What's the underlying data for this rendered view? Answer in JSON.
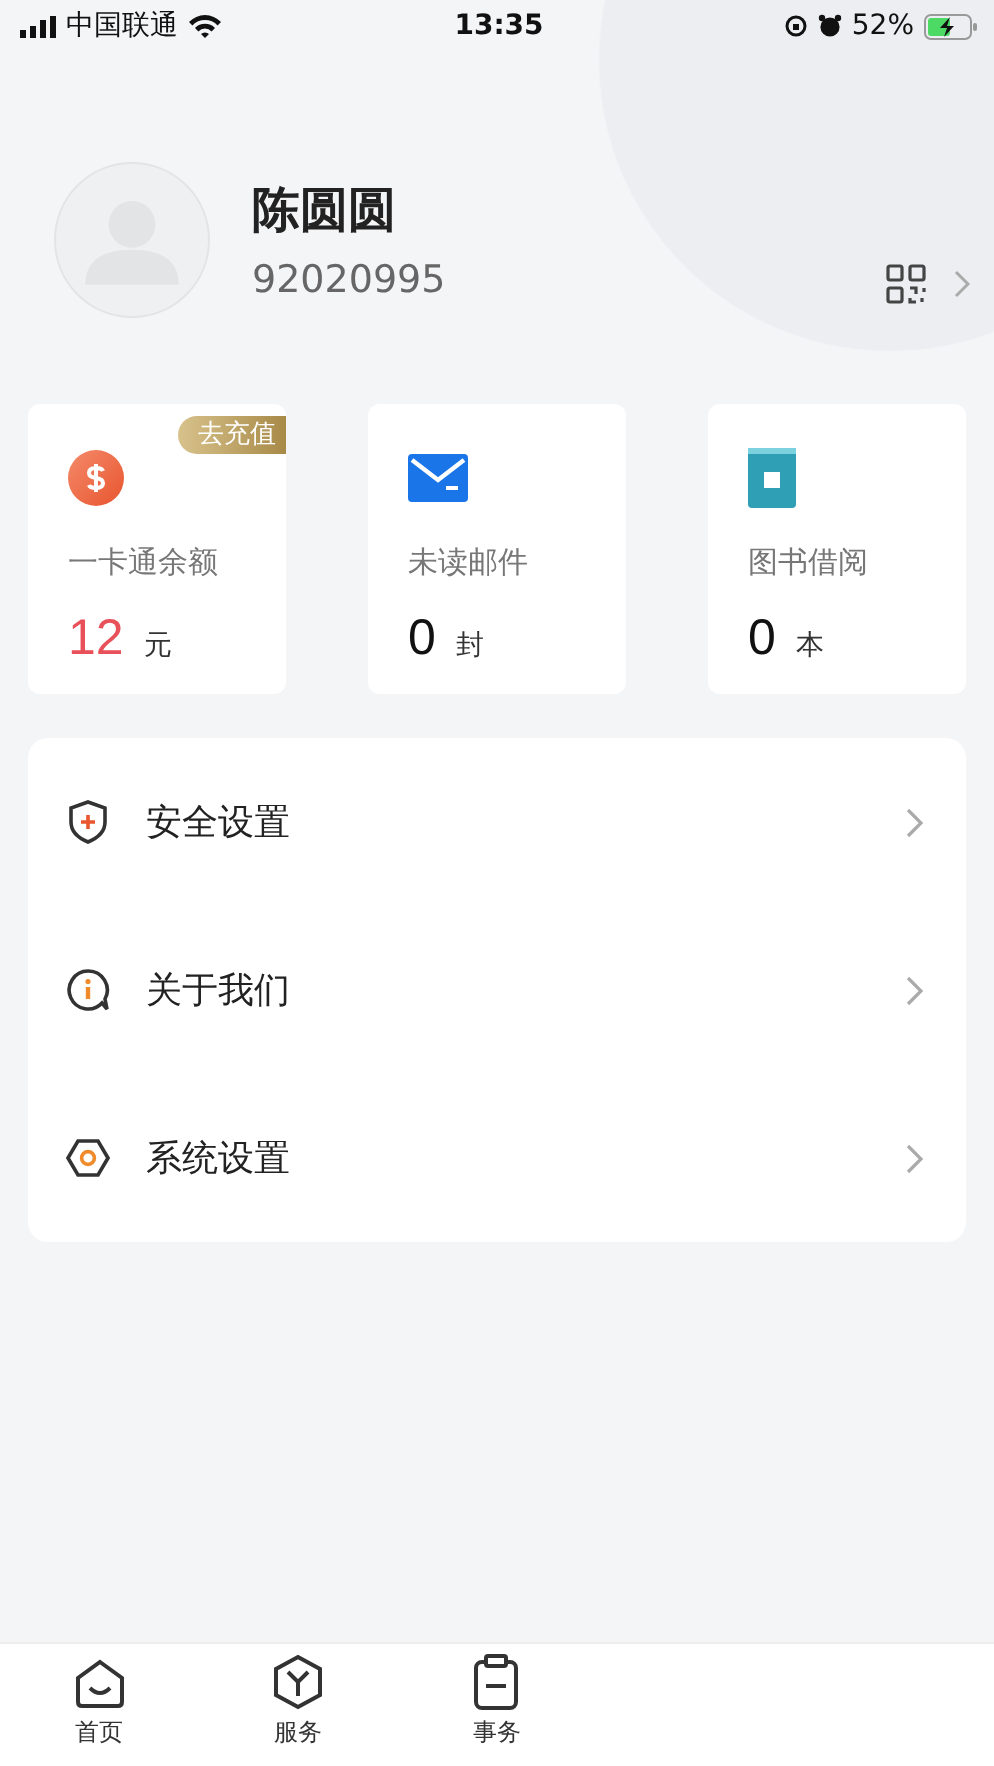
{
  "status_bar": {
    "carrier": "中国联通",
    "time": "13:35",
    "battery": "52%"
  },
  "profile": {
    "name": "陈圆圆",
    "id": "92020995"
  },
  "stats": [
    {
      "kind": "balance",
      "label": "一卡通余额",
      "value": "12",
      "unit": "元",
      "badge": "去充值"
    },
    {
      "kind": "mail",
      "label": "未读邮件",
      "value": "0",
      "unit": "封"
    },
    {
      "kind": "book",
      "label": "图书借阅",
      "value": "0",
      "unit": "本"
    }
  ],
  "menu": [
    {
      "kind": "security",
      "label": "安全设置"
    },
    {
      "kind": "about",
      "label": "关于我们"
    },
    {
      "kind": "system",
      "label": "系统设置"
    }
  ],
  "tabs": [
    {
      "kind": "home",
      "label": "首页",
      "selected": false
    },
    {
      "kind": "service",
      "label": "服务",
      "selected": false
    },
    {
      "kind": "affairs",
      "label": "事务",
      "selected": false
    }
  ]
}
